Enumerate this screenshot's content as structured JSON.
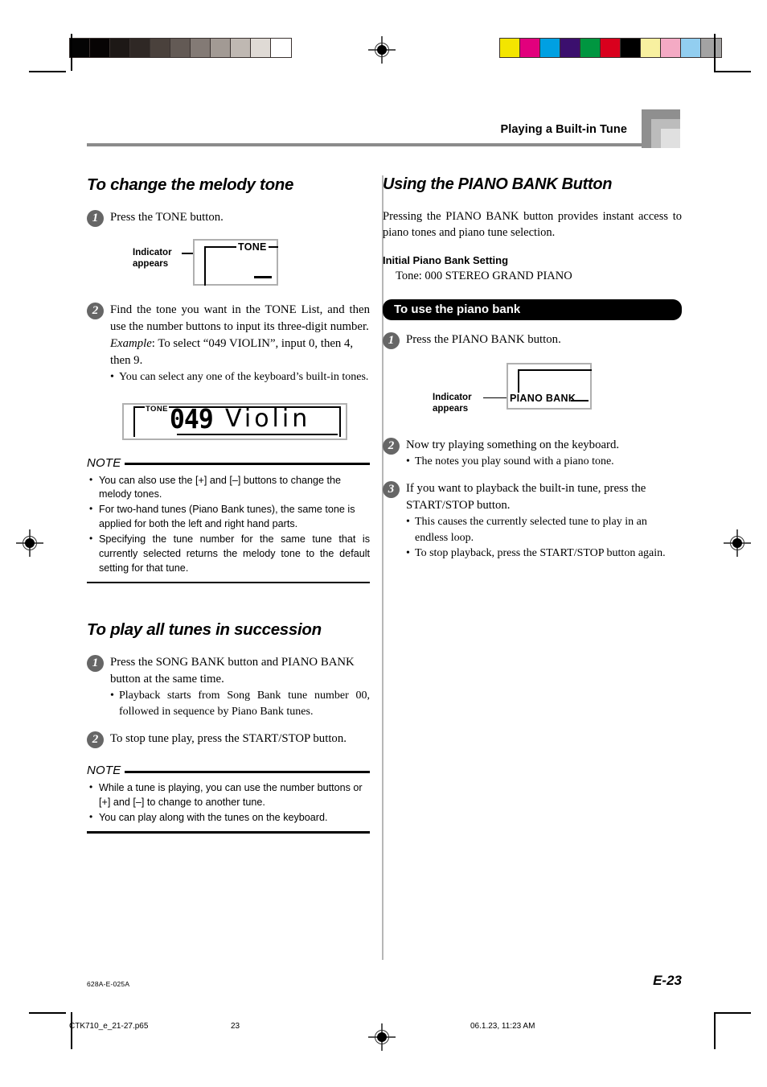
{
  "header": {
    "running_head": "Playing a Built-in Tune"
  },
  "calibration": {
    "gray_patches": [
      "#040404",
      "#070404",
      "#1d1816",
      "#2f2825",
      "#4a413c",
      "#635a55",
      "#837a75",
      "#a29a94",
      "#bfb8b2",
      "#dfdad5",
      "#ffffff"
    ],
    "color_patches": [
      "#f3e500",
      "#e2007d",
      "#00a0e2",
      "#3b0f6e",
      "#009640",
      "#d9001d",
      "#000000",
      "#f8f0a0",
      "#f4aac4",
      "#92cef0",
      "#a3a3a3"
    ]
  },
  "left_column": {
    "section1": {
      "title": "To change the melody tone",
      "step1": {
        "number": "1",
        "text": "Press the TONE button.",
        "figure": {
          "caption_line1": "Indicator",
          "caption_line2": "appears",
          "lcd_label": "TONE"
        }
      },
      "step2": {
        "number": "2",
        "text": "Find the tone you want in the TONE List, and then use the number buttons to input its three-digit number.",
        "example_label": "Example",
        "example_text": ":  To select “049 VIOLIN”, input 0, then 4, then 9.",
        "bullets": [
          "You can select any one of the keyboard’s built-in tones."
        ]
      },
      "readout": {
        "tone_label": "TONE",
        "digits": "049",
        "name": "Violin"
      },
      "note": {
        "label": "NOTE",
        "items": [
          "You can also use the [+] and [–] buttons to change the melody tones.",
          "For two-hand tunes (Piano Bank tunes), the same tone is applied for both the left and right hand parts.",
          "Specifying the tune number for the same tune that is currently selected returns the melody tone to the default setting for that tune."
        ]
      }
    },
    "section2": {
      "title": "To play all tunes in succession",
      "step1": {
        "number": "1",
        "text": "Press the SONG BANK button and PIANO BANK button at the same time.",
        "bullets": [
          "Playback starts from Song Bank tune number 00, followed in sequence by Piano Bank tunes."
        ]
      },
      "step2": {
        "number": "2",
        "text": "To stop tune play, press the START/STOP button."
      },
      "note": {
        "label": "NOTE",
        "items": [
          "While a tune is playing, you can use the number buttons or [+] and [–] to change to another tune.",
          "You can play along with the tunes on the keyboard."
        ]
      }
    }
  },
  "right_column": {
    "title": "Using the PIANO BANK Button",
    "intro": "Pressing the PIANO BANK button provides instant access to piano tones and piano tune selection.",
    "setting_head": "Initial Piano Bank Setting",
    "setting_value": "Tone: 000 STEREO GRAND PIANO",
    "banner": "To use the piano bank",
    "step1": {
      "number": "1",
      "text": "Press the PIANO BANK button.",
      "figure": {
        "caption_line1": "Indicator",
        "caption_line2": "appears",
        "lcd_label": "PIANO BANK"
      }
    },
    "step2": {
      "number": "2",
      "text": "Now try playing something on the keyboard.",
      "bullets": [
        "The notes you play sound with a piano tone."
      ]
    },
    "step3": {
      "number": "3",
      "text": "If you want to playback the built-in tune, press the START/STOP button.",
      "bullets": [
        "This causes the currently selected tune to play in an endless loop.",
        "To stop playback, press the START/STOP button again."
      ]
    }
  },
  "footer": {
    "doc_code": "628A-E-025A",
    "page_number": "E-23",
    "print_file": "CTK710_e_21-27.p65",
    "print_page": "23",
    "print_date": "06.1.23, 11:23 AM"
  }
}
